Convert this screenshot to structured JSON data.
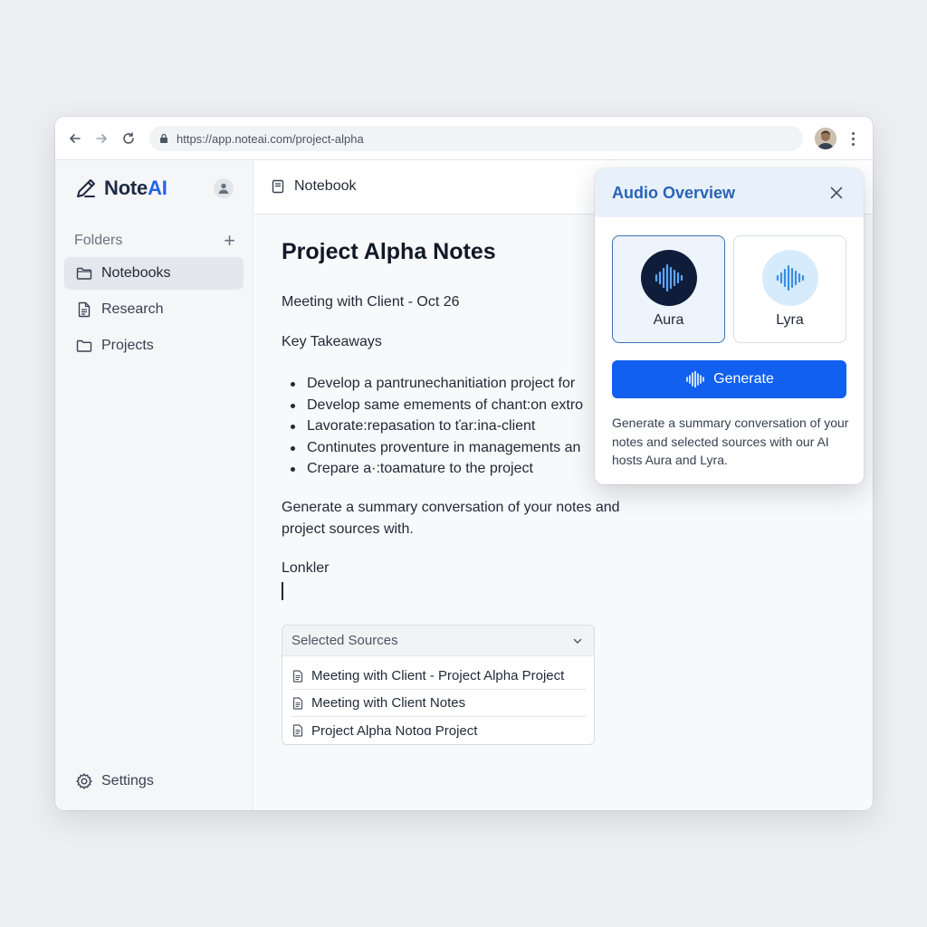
{
  "browser": {
    "url": "https://app.noteai.com/project-alpha"
  },
  "sidebar": {
    "brand_prefix": "Note",
    "brand_suffix": "AI",
    "folders_label": "Folders",
    "add_label": "+",
    "items": [
      {
        "label": "Notebooks",
        "icon": "folder-icon",
        "active": true
      },
      {
        "label": "Research",
        "icon": "document-icon",
        "active": false
      },
      {
        "label": "Projects",
        "icon": "folder-icon",
        "active": false
      }
    ],
    "settings_label": "Settings"
  },
  "main": {
    "tab_label": "Notebook",
    "title": "Project Alpha Notes",
    "meeting_line": "Meeting with Client - Oct 26",
    "takeaways_heading": "Key Takeaways",
    "bullets": [
      "Develop a pantrunechanitiation project for",
      "Develop same emements of chant:on extro",
      "Lavorate:repasation to ťar:ina-client",
      "Continutes proventure in managements an",
      "Crepare a·:toamature to the project"
    ],
    "summary_line1": "Generate a summary conversation of your notes and",
    "summary_line2": "project sources with.",
    "lonkler": "Lonkler",
    "sources": {
      "header": "Selected Sources",
      "items": [
        "Meeting with Client - Project Alpha Project",
        "Meeting with Client Notes",
        "Project Alpha Notoɑ Project"
      ]
    }
  },
  "audio_overview": {
    "title": "Audio Overview",
    "hosts": [
      {
        "name": "Aura",
        "selected": true
      },
      {
        "name": "Lyra",
        "selected": false
      }
    ],
    "generate_label": "Generate",
    "description": "Generate a summary conversation of your notes and selected sources with our AI hosts Aura and Lyra."
  },
  "colors": {
    "accent": "#1160f0",
    "brand_ai": "#2563eb",
    "popover_header": "#e8f1fb",
    "aura_orb": "#0f1d3a",
    "lyra_orb": "#d6ebfb"
  }
}
